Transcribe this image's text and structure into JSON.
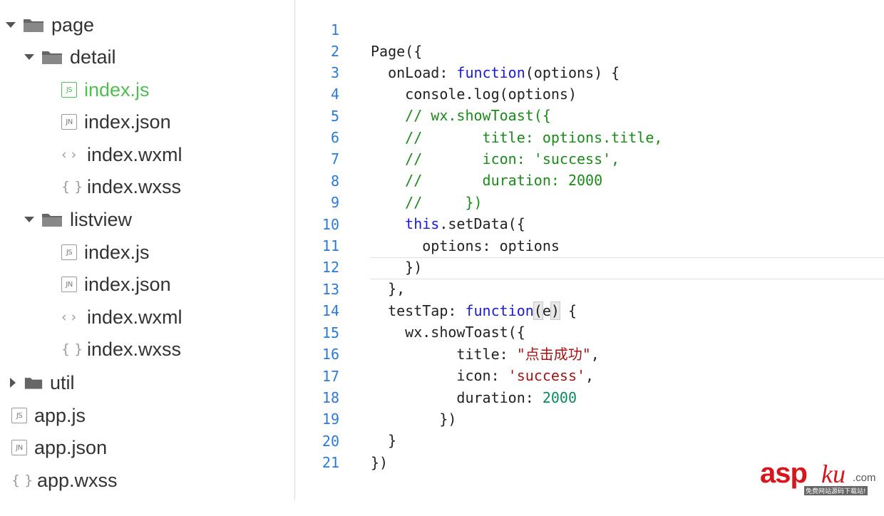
{
  "tree": {
    "page_folder": "page",
    "detail_folder": "detail",
    "detail_files": [
      {
        "badge": "JS",
        "name": "index.js"
      },
      {
        "badge": "JN",
        "name": "index.json"
      },
      {
        "glyph": "‹ ›",
        "name": "index.wxml"
      },
      {
        "glyph": "{ }",
        "name": "index.wxss"
      }
    ],
    "listview_folder": "listview",
    "listview_files": [
      {
        "badge": "JS",
        "name": "index.js"
      },
      {
        "badge": "JN",
        "name": "index.json"
      },
      {
        "glyph": "‹ ›",
        "name": "index.wxml"
      },
      {
        "glyph": "{ }",
        "name": "index.wxss"
      }
    ],
    "util_folder": "util",
    "root_files": [
      {
        "badge": "JS",
        "name": "app.js"
      },
      {
        "badge": "JN",
        "name": "app.json"
      },
      {
        "glyph": "{ }",
        "name": "app.wxss"
      }
    ]
  },
  "editor": {
    "line_numbers": [
      "1",
      "2",
      "3",
      "4",
      "5",
      "6",
      "7",
      "8",
      "9",
      "10",
      "11",
      "12",
      "13",
      "14",
      "15",
      "16",
      "17",
      "18",
      "19",
      "20",
      "21"
    ],
    "code": {
      "l1": "Page({",
      "l2_a": "  onLoad: ",
      "l2_kw": "function",
      "l2_b": "(options) {",
      "l3": "    console.log(options)",
      "l4": "    // wx.showToast({",
      "l5": "    //       title: options.title,",
      "l6": "    //       icon: 'success',",
      "l7": "    //       duration: 2000",
      "l8": "    //     })",
      "l9_kw": "    this",
      "l9_b": ".setData({",
      "l10": "      options: options",
      "l11": "    })",
      "l12": "  },",
      "l13_a": "  testTap: ",
      "l13_kw": "function",
      "l13_p1": "(",
      "l13_e": "e",
      "l13_p2": ")",
      "l13_b": " {",
      "l14": "    wx.showToast({",
      "l15_a": "          title: ",
      "l15_s": "\"点击成功\"",
      "l15_b": ",",
      "l16_a": "          icon: ",
      "l16_s": "'success'",
      "l16_b": ",",
      "l17_a": "          duration: ",
      "l17_n": "2000",
      "l18": "        })",
      "l19": "  }",
      "l20": "})",
      "l21": ""
    }
  },
  "watermark": {
    "brand": "asp",
    "brand_suffix": "ku",
    "domain": ".com",
    "tagline": "免费网站源码下载站!"
  },
  "colors": {
    "keyword": "#1a1ad6",
    "comment": "#1b8a1b",
    "string": "#a31515",
    "number": "#0a8a5a",
    "line_number": "#2b7bd6",
    "selected_file": "#4fc04f",
    "watermark": "#d8141c"
  }
}
